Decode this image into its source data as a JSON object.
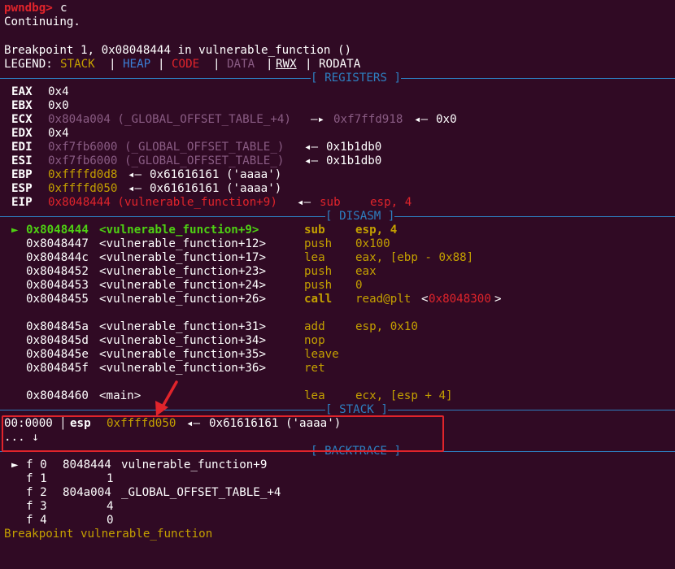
{
  "prompt": {
    "label": "pwndbg>",
    "command": "c"
  },
  "continuing": "Continuing.",
  "breakpoint_line": "Breakpoint 1, 0x08048444 in vulnerable_function ()",
  "legend": {
    "prefix": "LEGEND:",
    "items": [
      "STACK",
      "HEAP",
      "CODE",
      "DATA",
      "RWX",
      "RODATA"
    ],
    "separator": "|"
  },
  "sections": {
    "registers": "[ REGISTERS ]",
    "disasm": "[ DISASM ]",
    "stack": "[ STACK ]",
    "backtrace": "[ BACKTRACE ]"
  },
  "registers": [
    {
      "name": "EAX",
      "val": "0x4"
    },
    {
      "name": "EBX",
      "val": "0x0"
    },
    {
      "name": "ECX",
      "val": "0x804a004 (_GLOBAL_OFFSET_TABLE_+4)",
      "arrow": "—▸",
      "ptr": "0xf7ffd918",
      "arrow2": "◂—",
      "deref": "0x0"
    },
    {
      "name": "EDX",
      "val": "0x4"
    },
    {
      "name": "EDI",
      "val": "0xf7fb6000 (_GLOBAL_OFFSET_TABLE_)",
      "arrow": "◂—",
      "deref": "0x1b1db0"
    },
    {
      "name": "ESI",
      "val": "0xf7fb6000 (_GLOBAL_OFFSET_TABLE_)",
      "arrow": "◂—",
      "deref": "0x1b1db0"
    },
    {
      "name": "EBP",
      "val": "0xffffd0d8",
      "arrow": "◂—",
      "deref": "0x61616161 ('aaaa')"
    },
    {
      "name": "ESP",
      "val": "0xffffd050",
      "arrow": "◂—",
      "deref": "0x61616161 ('aaaa')"
    },
    {
      "name": "EIP",
      "val": "0x8048444 (vulnerable_function+9)",
      "arrow": "◂—",
      "deref_mn": "sub",
      "deref_ops": "esp, 4"
    }
  ],
  "disasm": [
    {
      "marker": "►",
      "addr": "0x8048444",
      "sym": "<vulnerable_function+9>",
      "mn": "sub",
      "ops": "esp, 4",
      "current": true
    },
    {
      "marker": "",
      "addr": "0x8048447",
      "sym": "<vulnerable_function+12>",
      "mn": "push",
      "ops": "0x100"
    },
    {
      "marker": "",
      "addr": "0x804844c",
      "sym": "<vulnerable_function+17>",
      "mn": "lea",
      "ops": "eax, [ebp - 0x88]"
    },
    {
      "marker": "",
      "addr": "0x8048452",
      "sym": "<vulnerable_function+23>",
      "mn": "push",
      "ops": "eax"
    },
    {
      "marker": "",
      "addr": "0x8048453",
      "sym": "<vulnerable_function+24>",
      "mn": "push",
      "ops": "0"
    },
    {
      "marker": "",
      "addr": "0x8048455",
      "sym": "<vulnerable_function+26>",
      "mn": "call",
      "ops": "read@plt",
      "ops_target": "0x8048300"
    },
    {
      "marker": "",
      "addr": "0x804845a",
      "sym": "<vulnerable_function+31>",
      "mn": "add",
      "ops": "esp, 0x10"
    },
    {
      "marker": "",
      "addr": "0x804845d",
      "sym": "<vulnerable_function+34>",
      "mn": "nop",
      "ops": ""
    },
    {
      "marker": "",
      "addr": "0x804845e",
      "sym": "<vulnerable_function+35>",
      "mn": "leave",
      "ops": ""
    },
    {
      "marker": "",
      "addr": "0x804845f",
      "sym": "<vulnerable_function+36>",
      "mn": "ret",
      "ops": ""
    },
    {
      "marker": "",
      "addr": "0x8048460",
      "sym": "<main>",
      "mn": "lea",
      "ops": "ecx, [esp + 4]"
    }
  ],
  "stack": {
    "offset": "00:0000",
    "reg": "esp",
    "addr": "0xffffd050",
    "arrow": "◂—",
    "value": "0x61616161 ('aaaa')",
    "more": "... ↓"
  },
  "backtrace": [
    {
      "marker": "►",
      "frame": "f 0",
      "addr": "8048444",
      "sym": "vulnerable_function+9"
    },
    {
      "marker": "",
      "frame": "f 1",
      "addr": "1",
      "sym": ""
    },
    {
      "marker": "",
      "frame": "f 2",
      "addr": "804a004",
      "sym": "_GLOBAL_OFFSET_TABLE_+4"
    },
    {
      "marker": "",
      "frame": "f 3",
      "addr": "4",
      "sym": ""
    },
    {
      "marker": "",
      "frame": "f 4",
      "addr": "0",
      "sym": ""
    }
  ],
  "footer": "Breakpoint vulnerable_function",
  "colors": {
    "background": "#300a24",
    "separator": "#2d7fc0",
    "stack": "#c4a000",
    "heap": "#3b7fd6",
    "code": "#e0242b",
    "data": "#8a5c84",
    "annotation": "#e0242b"
  }
}
